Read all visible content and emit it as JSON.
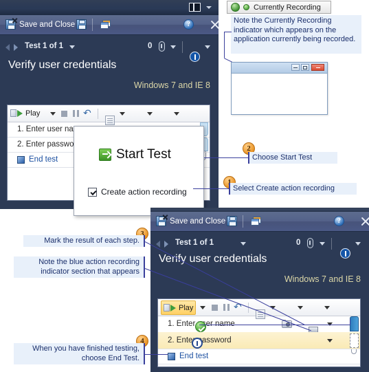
{
  "recording_badge": {
    "label": "Currently Recording",
    "globe_icon": "globe-icon",
    "dot_icon": "recording-dot-icon"
  },
  "callouts": {
    "recording_note": "Note the Currently Recording indicator which appears on the application currently being recorded.",
    "choose_start_test": "Choose Start Test",
    "select_create_recording": "Select Create action recording",
    "mark_result": "Mark the result of each step.",
    "blue_indicator": "Note the blue action recording indicator section that appears",
    "end_test_note": "When you have finished testing, choose End Test.",
    "numbers": {
      "one": "1",
      "two": "2",
      "three": "3",
      "four": "4"
    }
  },
  "window_top": {
    "command_bar": {
      "save_and_close": "Save and Close",
      "save_icon": "save-floppy-icon",
      "save_close_icon": "save-and-close-icon",
      "open_windows_icon": "windows-icon",
      "help_icon": "help-icon",
      "close_icon": "close-icon"
    },
    "layout_button_icon": "layout-toggle-icon",
    "nav": {
      "prev_icon": "previous-test-icon",
      "next_icon": "next-test-icon",
      "test_counter": "Test 1 of 1",
      "counter_caret_icon": "chevron-down-icon",
      "attachment_count": "0",
      "attachment_icon": "paperclip-icon",
      "attachment_caret_icon": "chevron-down-icon",
      "info_icon": "info-icon",
      "info_caret_icon": "chevron-down-icon"
    },
    "test_title": "Verify user credentials",
    "configuration": "Windows 7 and IE 8",
    "expand_icon": "chevron-down-icon",
    "toolbar": {
      "play_label": "Play",
      "play_icon": "play-icon",
      "play_caret_icon": "chevron-down-icon",
      "stop_icon": "stop-icon",
      "pause_icon": "pause-icon",
      "undo_icon": "undo-icon",
      "edit_icon": "edit-step-icon",
      "edit_caret_icon": "chevron-down-icon",
      "camera_icon": "screenshot-icon",
      "camera_caret_icon": "chevron-down-icon",
      "monitor_icon": "system-info-icon",
      "monitor_caret_icon": "chevron-down-icon",
      "screen_icon": "screen-recorder-icon",
      "attach_icon": "attachment-icon"
    },
    "steps": [
      {
        "text": "1. Enter user na",
        "type": "step"
      },
      {
        "text": "2. Enter passwo",
        "type": "step"
      },
      {
        "text": "End test",
        "type": "end",
        "icon": "end-test-icon"
      }
    ]
  },
  "popup": {
    "start_test_label": "Start Test",
    "start_test_icon": "start-test-arrow-icon",
    "checkbox_label": "Create action recording",
    "checkbox_icon": "checkbox-checked-icon",
    "checkbox_checked": true
  },
  "sample_app": {
    "minimize_icon": "minimize-icon",
    "maximize_icon": "maximize-icon",
    "close_icon": "close-icon"
  },
  "window_bottom": {
    "command_bar": {
      "save_and_close": "Save and Close",
      "save_icon": "save-floppy-icon",
      "save_close_icon": "save-and-close-icon",
      "open_windows_icon": "windows-icon",
      "help_icon": "help-icon",
      "close_icon": "close-icon"
    },
    "nav": {
      "prev_icon": "previous-test-icon",
      "next_icon": "next-test-icon",
      "test_counter": "Test 1 of 1",
      "counter_caret_icon": "chevron-down-icon",
      "attachment_count": "0",
      "attachment_icon": "paperclip-icon",
      "attachment_caret_icon": "chevron-down-icon",
      "info_icon": "info-icon",
      "info_caret_icon": "chevron-down-icon"
    },
    "test_title": "Verify user credentials",
    "configuration": "Windows 7 and IE 8",
    "expand_icon": "chevron-down-icon",
    "toolbar": {
      "play_label": "Play",
      "play_icon": "play-icon",
      "play_caret_icon": "chevron-down-icon",
      "stop_icon": "stop-icon",
      "pause_icon": "pause-icon",
      "undo_icon": "undo-icon",
      "edit_icon": "edit-step-icon",
      "edit_caret_icon": "chevron-down-icon",
      "camera_icon": "screenshot-icon",
      "camera_caret_icon": "chevron-down-icon",
      "monitor_icon": "system-info-icon",
      "monitor_caret_icon": "chevron-down-icon",
      "screen_icon": "screen-recorder-icon",
      "attach_icon": "attachment-icon"
    },
    "steps": [
      {
        "text": "1. Enter user name",
        "type": "step",
        "result": "pass",
        "result_icon": "pass-icon"
      },
      {
        "text": "2. Enter password",
        "type": "step",
        "result": "info",
        "result_icon": "info-icon",
        "selected": true
      },
      {
        "text": "End test",
        "type": "end",
        "icon": "end-test-icon"
      }
    ]
  },
  "colors": {
    "accent_blue": "#2c3a55",
    "callout_text": "#1b2f6b",
    "callout_bg": "#e8f0fa",
    "bubble": "#e8901e",
    "selected_row": "#faeab5",
    "recording_blue": "#2f7dbd"
  }
}
